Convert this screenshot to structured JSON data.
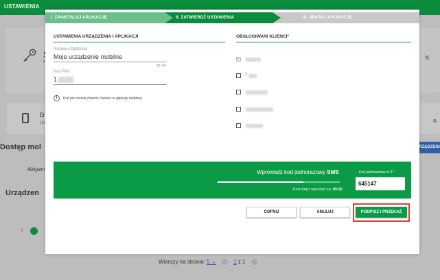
{
  "background": {
    "topbar_title": "USTAWIENIA",
    "card1": {
      "letter": "S",
      "small": "K",
      "right_letter": "N"
    },
    "card2": {
      "letter": "D",
      "small": "Uz",
      "right_text": "q."
    },
    "dostep_title": "Dostęp mol",
    "right_button": "RZĄDZENIE",
    "tab_active": "Aktywn",
    "section_title": "Urządzen",
    "row_number": "1",
    "footer": {
      "rows_label": "Wierszy na stronie:",
      "rows_value": "5",
      "page_current": "1",
      "page_sep": "z",
      "page_total": "1"
    }
  },
  "stepper": {
    "step1": "I. ZAINSTALUJ APLIKACJĘ",
    "step2": "II. ZATWIERDŹ USTAWIENIA",
    "step3": "III. SPARUJ APLIKACJĘ"
  },
  "left_section": {
    "title": "USTAWIENIA URZĄDZENIA I APLIKACJI",
    "name_label": "Nazwa urządzenia",
    "name_value": "Moje urządzenie mobilne",
    "name_counter": "23 / 50",
    "pin_label": "Kod PIN",
    "pin_value": "1",
    "info_text": "Kod pin można zmienić również w aplikacji mobilnej"
  },
  "right_section": {
    "title": "OBSŁUGIWANI KLIENCI*",
    "clients": [
      {
        "checked": true,
        "label": ""
      },
      {
        "checked": false,
        "label": "2"
      },
      {
        "checked": false,
        "label": ""
      },
      {
        "checked": false,
        "label": ""
      },
      {
        "checked": false,
        "label": ""
      }
    ]
  },
  "sms": {
    "title_prefix": "Wprowadź kod jednorazowy",
    "title_bold": "SMS",
    "progress": 0.7,
    "expire_prefix": "Kod straci ważność za:",
    "expire_time": "00:20",
    "code_label": "Kod jednorazowy nr 3 *",
    "code_value": "645147"
  },
  "buttons": {
    "back": "COFNIJ",
    "cancel": "ANULUJ",
    "submit": "PODPISZ I PRZEKAŻ"
  },
  "colors": {
    "brand_green": "#0b8c3d",
    "highlight": "#e03a3a"
  }
}
